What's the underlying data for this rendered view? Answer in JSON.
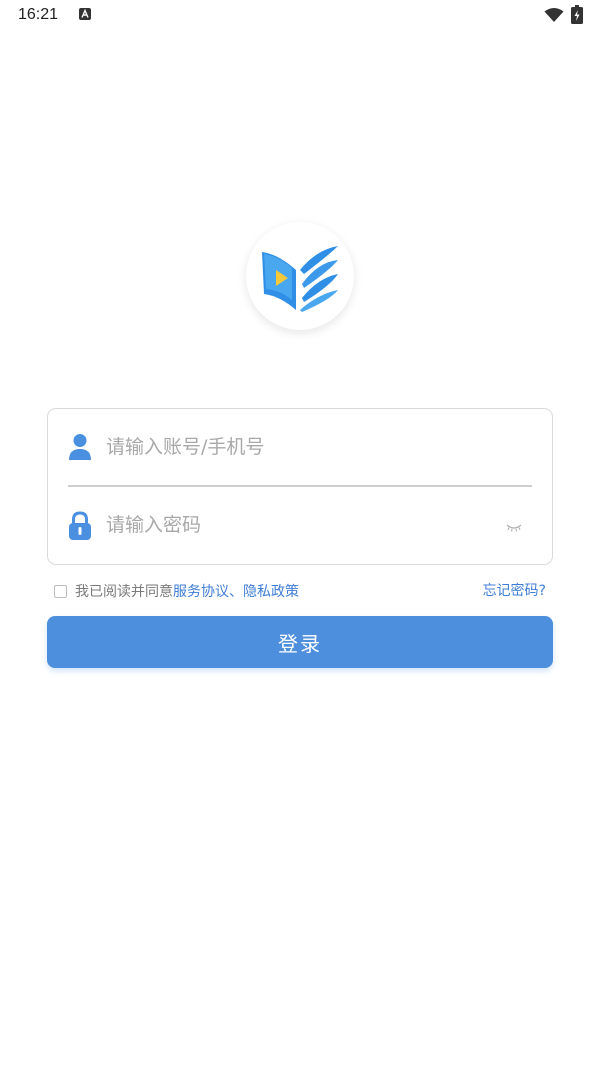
{
  "status_bar": {
    "time": "16:21"
  },
  "login_form": {
    "account_placeholder": "请输入账号/手机号",
    "password_placeholder": "请输入密码",
    "account_value": "",
    "password_value": ""
  },
  "agreement": {
    "prefix": "我已阅读并同意",
    "service_link": "服务协议",
    "separator": "、",
    "privacy_link": "隐私政策",
    "checked": false
  },
  "forgot_password": "忘记密码?",
  "login_button": "登录",
  "icons": {
    "account": "user-icon",
    "password": "lock-icon",
    "toggle": "eye-closed-icon",
    "logo": "book-play-logo"
  },
  "colors": {
    "accent": "#4d8fdd",
    "link": "#3f7ed6",
    "icon": "#4a8fe0"
  }
}
